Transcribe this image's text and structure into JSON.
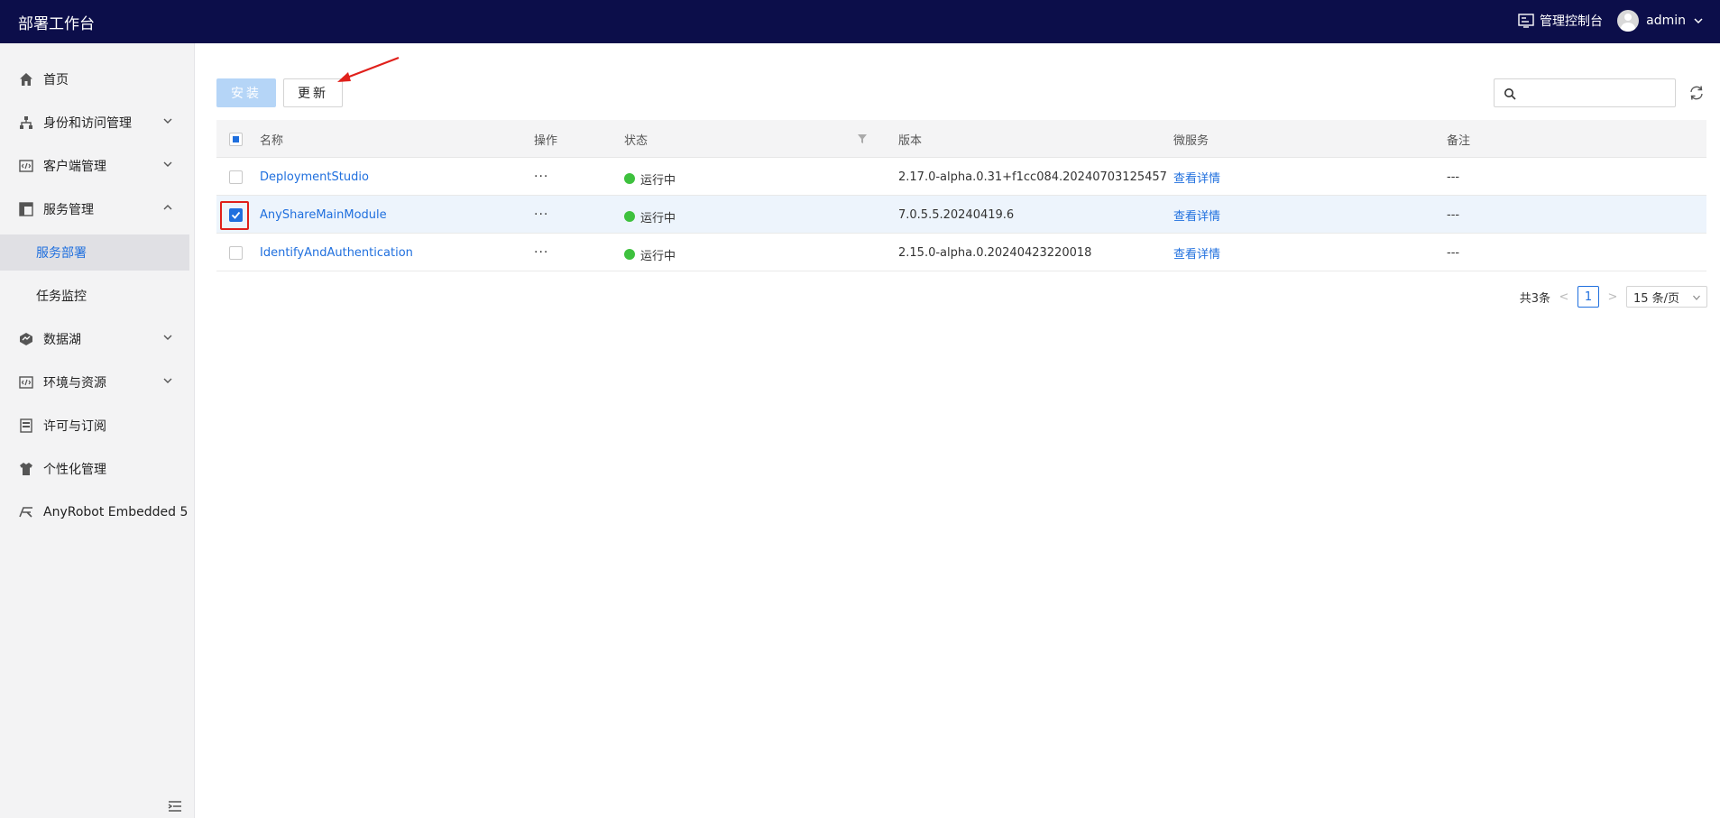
{
  "header": {
    "app_title": "部署工作台",
    "console_label": "管理控制台",
    "username": "admin",
    "bg_color": "#0c0e4a"
  },
  "sidebar": {
    "items": [
      {
        "label": "首页",
        "icon": "home-icon",
        "expandable": false
      },
      {
        "label": "身份和访问管理",
        "icon": "org-tree-icon",
        "expandable": true,
        "expanded": false
      },
      {
        "label": "客户端管理",
        "icon": "code-window-icon",
        "expandable": true,
        "expanded": false
      },
      {
        "label": "服务管理",
        "icon": "layout-icon",
        "expandable": true,
        "expanded": true,
        "children": [
          {
            "label": "服务部署",
            "active": true
          },
          {
            "label": "任务监控",
            "active": false
          }
        ]
      },
      {
        "label": "数据湖",
        "icon": "lake-icon",
        "expandable": true,
        "expanded": false
      },
      {
        "label": "环境与资源",
        "icon": "code-window-icon",
        "expandable": true,
        "expanded": false
      },
      {
        "label": "许可与订阅",
        "icon": "license-icon",
        "expandable": false
      },
      {
        "label": "个性化管理",
        "icon": "shirt-icon",
        "expandable": false
      },
      {
        "label": "AnyRobot Embedded 5",
        "icon": "anyrobot-icon",
        "expandable": false
      }
    ]
  },
  "toolbar": {
    "install_label": "安装",
    "update_label": "更新",
    "search_placeholder": ""
  },
  "table": {
    "columns": [
      "名称",
      "操作",
      "状态",
      "版本",
      "微服务",
      "备注"
    ],
    "rows": [
      {
        "name": "DeploymentStudio",
        "op": "···",
        "status": "运行中",
        "version": "2.17.0-alpha.0.31+f1cc084.20240703125457",
        "microservice": "查看详情",
        "note": "---",
        "selected": false
      },
      {
        "name": "AnyShareMainModule",
        "op": "···",
        "status": "运行中",
        "version": "7.0.5.5.20240419.6",
        "microservice": "查看详情",
        "note": "---",
        "selected": true
      },
      {
        "name": "IdentifyAndAuthentication",
        "op": "···",
        "status": "运行中",
        "version": "2.15.0-alpha.0.20240423220018",
        "microservice": "查看详情",
        "note": "---",
        "selected": false
      }
    ]
  },
  "pagination": {
    "total_label": "共3条",
    "current_page": "1",
    "page_size_label": "15 条/页"
  },
  "colors": {
    "accent": "#1f6fde",
    "status_running": "#3ec13e",
    "highlight": "#e0201b"
  }
}
